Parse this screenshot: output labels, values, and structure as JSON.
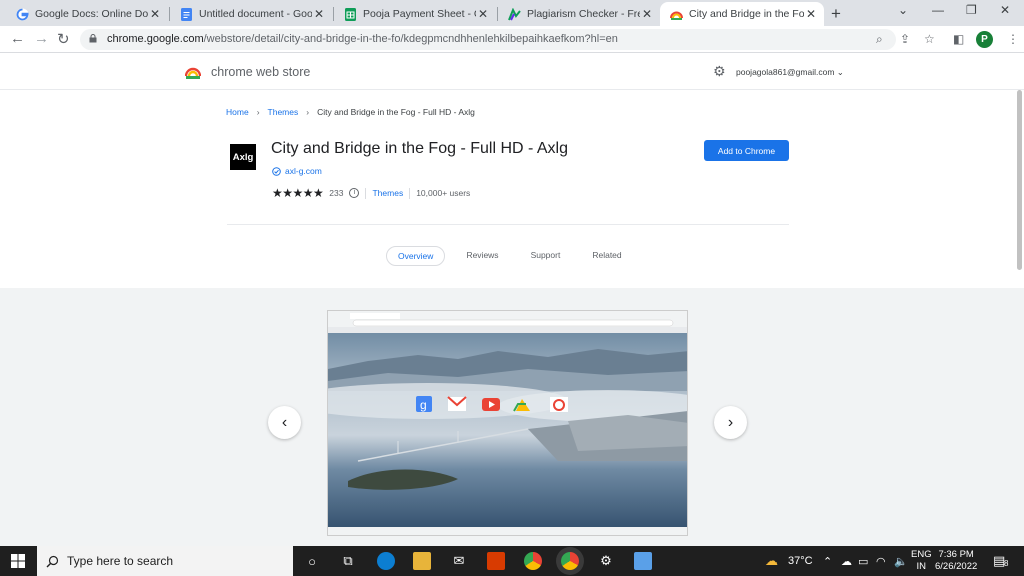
{
  "browser": {
    "tabs": [
      {
        "title": "Google Docs: Online Docume",
        "icon": "google-icon"
      },
      {
        "title": "Untitled document - Google",
        "icon": "docs-icon"
      },
      {
        "title": "Pooja Payment Sheet - Goog",
        "icon": "sheets-icon"
      },
      {
        "title": "Plagiarism Checker - Free &",
        "icon": "plagiarism-icon"
      },
      {
        "title": "City and Bridge in the Fog - F",
        "icon": "webstore-icon",
        "active": true
      }
    ],
    "url_host": "chrome.google.com",
    "url_path": "/webstore/detail/city-and-bridge-in-the-fo/kdegpmcndhhenlehkilbepaihkaefkom?hl=en",
    "profile_initial": "P"
  },
  "store": {
    "name": "chrome web store",
    "account": "poojagola861@gmail.com"
  },
  "breadcrumb": [
    "Home",
    "Themes",
    "City and Bridge in the Fog - Full HD - Axlg"
  ],
  "extension": {
    "logo_text": "Axlg",
    "title": "City and Bridge in the Fog - Full HD - Axlg",
    "publisher": "axl-g.com",
    "rating_count": "233",
    "stars": 4.5,
    "category": "Themes",
    "users": "10,000+ users",
    "add_button": "Add to Chrome"
  },
  "subtabs": [
    "Overview",
    "Reviews",
    "Support",
    "Related"
  ],
  "active_subtab": "Overview",
  "taskbar": {
    "search_placeholder": "Type here to search",
    "temperature": "37°C",
    "lang_line1": "ENG",
    "lang_line2": "IN",
    "time": "7:36 PM",
    "date": "6/26/2022",
    "notification_count": "8"
  },
  "colors": {
    "accent": "#1a73e8",
    "tabstrip": "#dee1e6",
    "taskbar": "#1f1f1f"
  }
}
